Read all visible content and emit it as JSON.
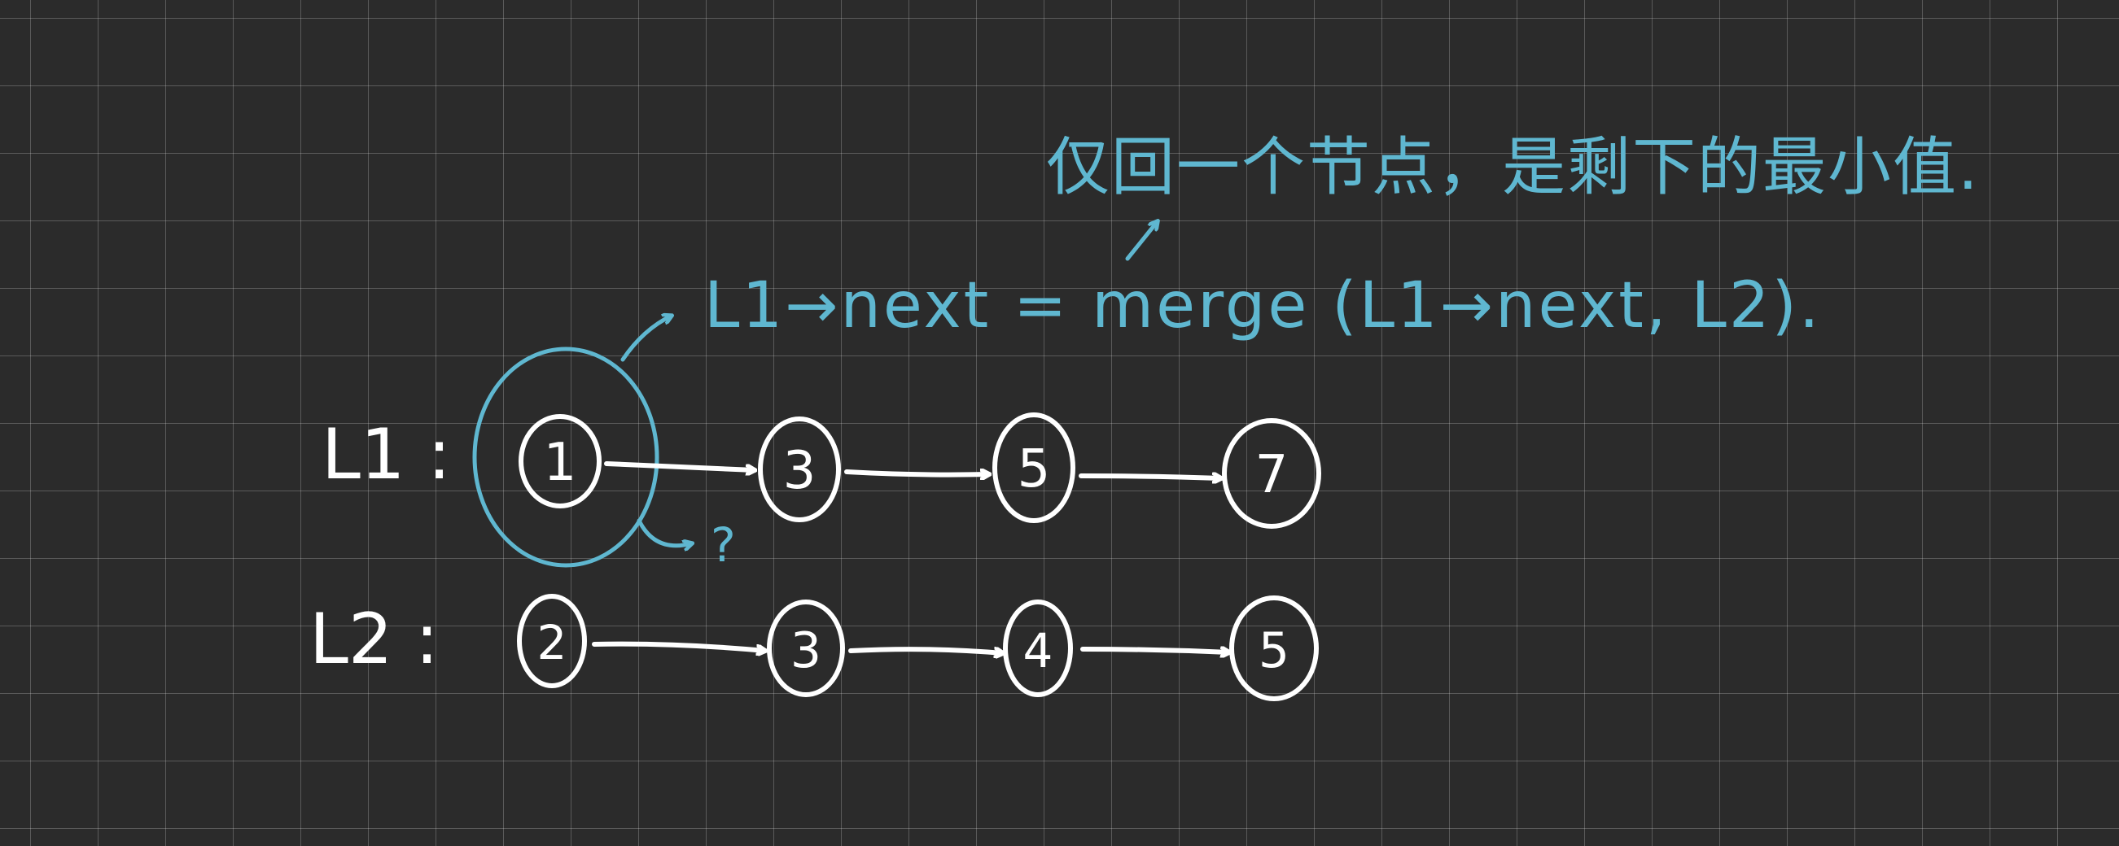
{
  "annotation_top": "仅回一个节点，是剩下的最小值.",
  "formula": "L1→next = merge (L1→next, L2).",
  "question_mark": "?",
  "lists": [
    {
      "label": "L1 :",
      "nodes": [
        "1",
        "3",
        "5",
        "7"
      ]
    },
    {
      "label": "L2 :",
      "nodes": [
        "2",
        "3",
        "4",
        "5"
      ]
    }
  ],
  "colors": {
    "background": "#2b2b2b",
    "grid": "#5a5a5a",
    "white_ink": "#ffffff",
    "blue_ink": "#5fb7d0"
  }
}
